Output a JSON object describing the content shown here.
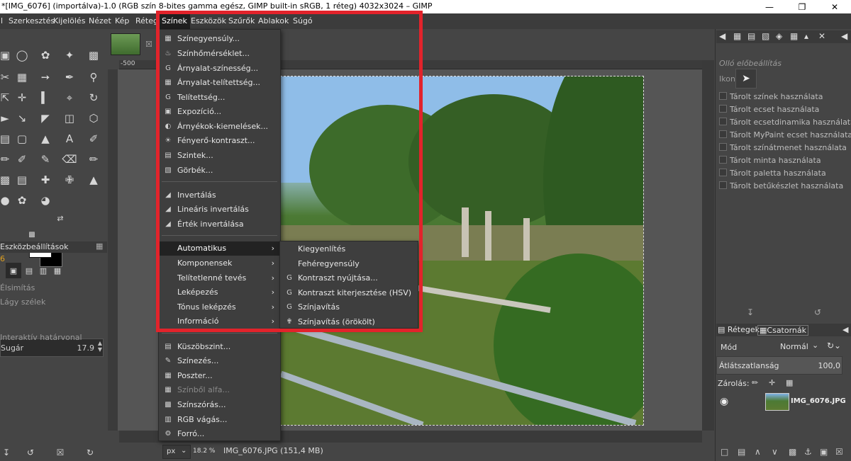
{
  "window": {
    "title": "*[IMG_6076] (importálva)-1.0 (RGB szín 8-bites gamma egész, GIMP built-in sRGB, 1 réteg) 4032x3024 – GIMP",
    "minimize_icon": "minimize-icon",
    "maximize_icon": "restore-icon",
    "close_icon": "close-icon"
  },
  "menubar": {
    "items": [
      "l",
      "Szerkesztés",
      "Kijelölés",
      "Nézet",
      "Kép",
      "Réteg",
      "Színek",
      "Eszközök",
      "Szűrők",
      "Ablakok",
      "Súgó"
    ],
    "active": "Színek"
  },
  "colors_menu": {
    "items": [
      {
        "label": "Színegyensúly...",
        "icon": "color-balance-icon"
      },
      {
        "label": "Színhőmérséklet...",
        "icon": "color-temperature-icon"
      },
      {
        "label": "Árnyalat-színesség...",
        "icon": "gimp-g-icon"
      },
      {
        "label": "Árnyalat-telítettség...",
        "icon": "hue-saturation-icon"
      },
      {
        "label": "Telítettség...",
        "icon": "gimp-g-icon"
      },
      {
        "label": "Expozíció...",
        "icon": "exposure-icon"
      },
      {
        "label": "Árnyékok-kiemelések...",
        "icon": "shadows-highlights-icon"
      },
      {
        "label": "Fényerő-kontraszt...",
        "icon": "brightness-contrast-icon"
      },
      {
        "label": "Szintek...",
        "icon": "levels-icon"
      },
      {
        "label": "Görbék...",
        "icon": "curves-icon"
      },
      {
        "label": "Invertálás",
        "icon": "invert-icon"
      },
      {
        "label": "Lineáris invertálás",
        "icon": "invert-icon"
      },
      {
        "label": "Érték invertálása",
        "icon": "invert-icon"
      },
      {
        "label": "Automatikus",
        "icon": "",
        "submenu": true
      },
      {
        "label": "Komponensek",
        "icon": "",
        "submenu": true
      },
      {
        "label": "Telítetlenné tevés",
        "icon": "",
        "submenu": true
      },
      {
        "label": "Leképezés",
        "icon": "",
        "submenu": true
      },
      {
        "label": "Tónus leképzés",
        "icon": "",
        "submenu": true
      },
      {
        "label": "Információ",
        "icon": "",
        "submenu": true
      },
      {
        "label": "Küszöbszint...",
        "icon": "threshold-icon"
      },
      {
        "label": "Színezés...",
        "icon": "colorize-icon"
      },
      {
        "label": "Poszter...",
        "icon": "posterize-icon"
      },
      {
        "label": "Színből alfa...",
        "icon": "color-to-alpha-icon",
        "disabled": true
      },
      {
        "label": "Színszórás...",
        "icon": "dither-icon"
      },
      {
        "label": "RGB vágás...",
        "icon": "rgb-clip-icon"
      },
      {
        "label": "Forró...",
        "icon": "hot-icon"
      }
    ]
  },
  "auto_submenu": {
    "items": [
      {
        "label": "Kiegyenlítés",
        "icon": ""
      },
      {
        "label": "Fehéregyensúly",
        "icon": ""
      },
      {
        "label": "Kontraszt nyújtása...",
        "icon": "gimp-g-icon"
      },
      {
        "label": "Kontraszt kiterjesztése (HSV)",
        "icon": "gimp-g-icon"
      },
      {
        "label": "Színjavítás",
        "icon": "gimp-g-icon"
      },
      {
        "label": "Színjavítás (örökölt)",
        "icon": "plugin-icon"
      }
    ]
  },
  "tool_options": {
    "tab_label": "Eszközbeállítások",
    "antialias": "Élsimítás",
    "feather": "Lágy szélek",
    "radius_label": "Sugár",
    "radius_value": "17.9",
    "interactive_boundary": "Interaktív határvonal",
    "mode_digit": "6"
  },
  "ruler": {
    "left_label": "-500"
  },
  "statusbar": {
    "unit": "px",
    "zoom": "18.2 %",
    "file_info": "IMG_6076.JPG (151,4 MB)"
  },
  "right_dock": {
    "tool_presets_title": "Olló előbeállítás",
    "icon_label": "Ikon:",
    "checkboxes": [
      "Tárolt színek használata",
      "Tárolt ecset használata",
      "Tárolt ecsetdinamika használata",
      "Tárolt MyPaint ecset használata",
      "Tárolt színátmenet használata",
      "Tárolt minta használata",
      "Tárolt paletta használata",
      "Tárolt betűkészlet használata"
    ],
    "tabs": [
      "Rétegek",
      "Csatornák"
    ],
    "mode_label": "Mód",
    "mode_value": "Normál",
    "opacity_label": "Átlátszatlanság",
    "opacity_value": "100,0",
    "lock_label": "Zárolás:",
    "layer_name": "IMG_6076.JPG"
  },
  "accent": {
    "highlight": "#e2232b"
  }
}
